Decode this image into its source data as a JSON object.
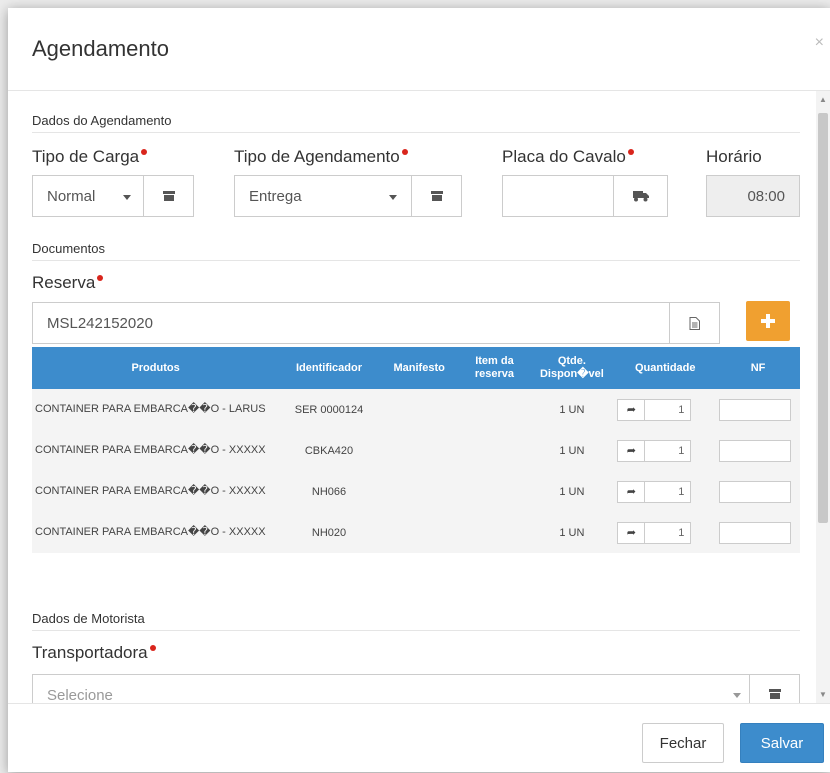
{
  "modal": {
    "title": "Agendamento",
    "close_glyph": "×"
  },
  "sections": {
    "agendamento": "Dados do Agendamento",
    "documentos": "Documentos",
    "motorista": "Dados de Motorista"
  },
  "form": {
    "tipo_carga": {
      "label": "Tipo de Carga",
      "value": "Normal"
    },
    "tipo_agendamento": {
      "label": "Tipo de Agendamento",
      "value": "Entrega"
    },
    "placa_cavalo": {
      "label": "Placa do Cavalo",
      "value": ""
    },
    "horario": {
      "label": "Horário",
      "value": "08:00"
    },
    "reserva": {
      "label": "Reserva",
      "value": "MSL242152020"
    },
    "transportadora": {
      "label": "Transportadora",
      "placeholder": "Selecione"
    }
  },
  "table": {
    "headers": [
      "Produtos",
      "Identificador",
      "Manifesto",
      "Item da reserva",
      "Qtde. Dispon�vel",
      "Quantidade",
      "NF"
    ],
    "rows": [
      {
        "produto": "CONTAINER PARA EMBARCA��O - LARUS",
        "identificador": "SER 0000124",
        "manifesto": "",
        "item": "",
        "qtde": "1 UN",
        "quantidade": "1",
        "nf": ""
      },
      {
        "produto": "CONTAINER PARA EMBARCA��O - XXXXX",
        "identificador": "CBKA420",
        "manifesto": "",
        "item": "",
        "qtde": "1 UN",
        "quantidade": "1",
        "nf": ""
      },
      {
        "produto": "CONTAINER PARA EMBARCA��O - XXXXX",
        "identificador": "NH066",
        "manifesto": "",
        "item": "",
        "qtde": "1 UN",
        "quantidade": "1",
        "nf": ""
      },
      {
        "produto": "CONTAINER PARA EMBARCA��O - XXXXX",
        "identificador": "NH020",
        "manifesto": "",
        "item": "",
        "qtde": "1 UN",
        "quantidade": "1",
        "nf": ""
      }
    ]
  },
  "footer": {
    "fechar": "Fechar",
    "salvar": "Salvar"
  },
  "icons": {
    "archive": "archive-icon",
    "truck": "truck-icon",
    "document": "document-icon",
    "plus": "plus-icon",
    "share": "share-icon"
  },
  "colors": {
    "primary": "#3d8ccc",
    "accent": "#f0a030",
    "required": "#d9251c"
  }
}
